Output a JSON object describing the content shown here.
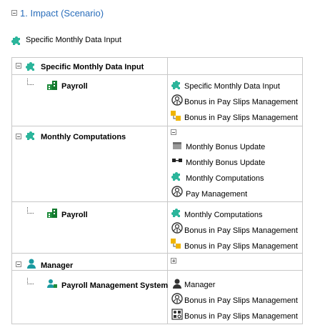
{
  "header": {
    "title": "1. Impact (Scenario)"
  },
  "subtitle": {
    "label": "Specific Monthly Data Input"
  },
  "rows": [
    {
      "left": "Specific Monthly Data Input",
      "right": []
    },
    {
      "left": "Payroll",
      "right": [
        "Specific Monthly Data Input",
        "Bonus in Pay Slips Management",
        "Bonus in Pay Slips Management"
      ]
    },
    {
      "left": "Monthly Computations",
      "right": [
        "Monthly Bonus Update",
        "Monthly Bonus Update",
        "Monthly Computations",
        "Pay Management"
      ]
    },
    {
      "left": "Payroll",
      "right": [
        "Monthly Computations",
        "Bonus in Pay Slips Management",
        "Bonus in Pay Slips Management"
      ]
    },
    {
      "left": "Manager",
      "right": []
    },
    {
      "left": "Payroll Management System",
      "right": [
        "Manager",
        "Bonus in Pay Slips Management",
        "Bonus in Pay Slips Management"
      ]
    }
  ],
  "icons": {
    "process": "puzzle-icon",
    "organization": "organization-icon",
    "function": "function-icon",
    "event": "event-icon",
    "role": "role-icon",
    "system": "application-system-icon",
    "data": "data-cluster-icon",
    "connector": "connector-icon"
  },
  "colors": {
    "accent": "#2a6ebb",
    "puzzle": "#2bb59b",
    "org_green": "#1e8c3c",
    "event_yellow": "#f0b400",
    "role_teal": "#1a9aa0",
    "grid": "#c8c8c8"
  }
}
